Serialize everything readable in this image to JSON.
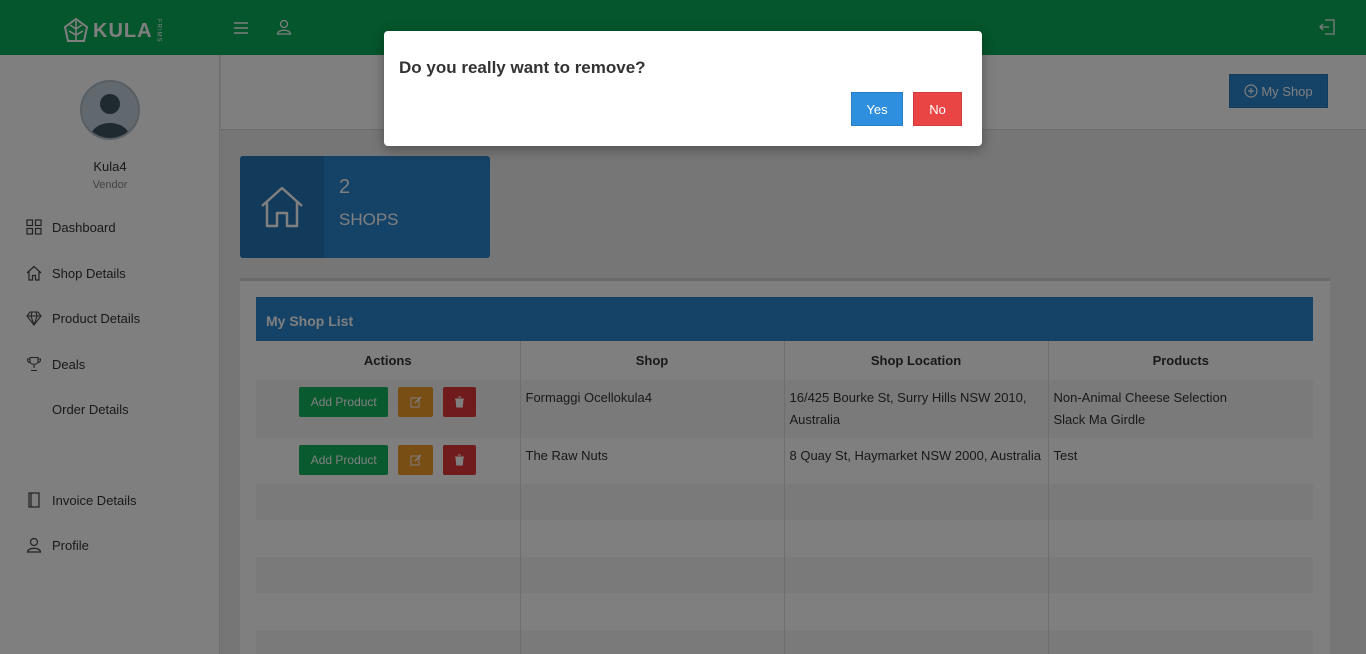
{
  "brand": {
    "name": "KULA",
    "sub": "FRIMS"
  },
  "header": {
    "my_shop_label": "My Shop"
  },
  "user": {
    "name": "Kula4",
    "role": "Vendor"
  },
  "sidebar": {
    "items": [
      {
        "label": "Dashboard",
        "icon": "grid-icon"
      },
      {
        "label": "Shop Details",
        "icon": "home-icon"
      },
      {
        "label": "Product Details",
        "icon": "diamond-icon"
      },
      {
        "label": "Deals",
        "icon": "trophy-icon"
      },
      {
        "label": "Order Details",
        "icon": ""
      },
      {
        "label": "Invoice Details",
        "icon": "book-icon"
      },
      {
        "label": "Profile",
        "icon": "user-icon"
      }
    ]
  },
  "stats": {
    "shops_count": "2",
    "shops_label": "SHOPS"
  },
  "shop_list": {
    "title": "My Shop List",
    "columns": [
      "Actions",
      "Shop",
      "Shop Location",
      "Products"
    ],
    "add_product_label": "Add Product",
    "rows": [
      {
        "shop": "Formaggi Ocellokula4",
        "location": "16/425 Bourke St, Surry Hills NSW 2010, Australia",
        "products": [
          "Non-Animal Cheese Selection",
          "Slack Ma Girdle"
        ]
      },
      {
        "shop": "The Raw Nuts",
        "location": "8 Quay St, Haymarket NSW 2000, Australia",
        "products": [
          "Test"
        ]
      }
    ]
  },
  "modal": {
    "question": "Do you really want to remove?",
    "yes_label": "Yes",
    "no_label": "No"
  },
  "colors": {
    "topbar": "#0aac58",
    "primary": "#2b87d1",
    "success": "#12b55e",
    "warning": "#f39c2a",
    "danger": "#e0393b"
  }
}
